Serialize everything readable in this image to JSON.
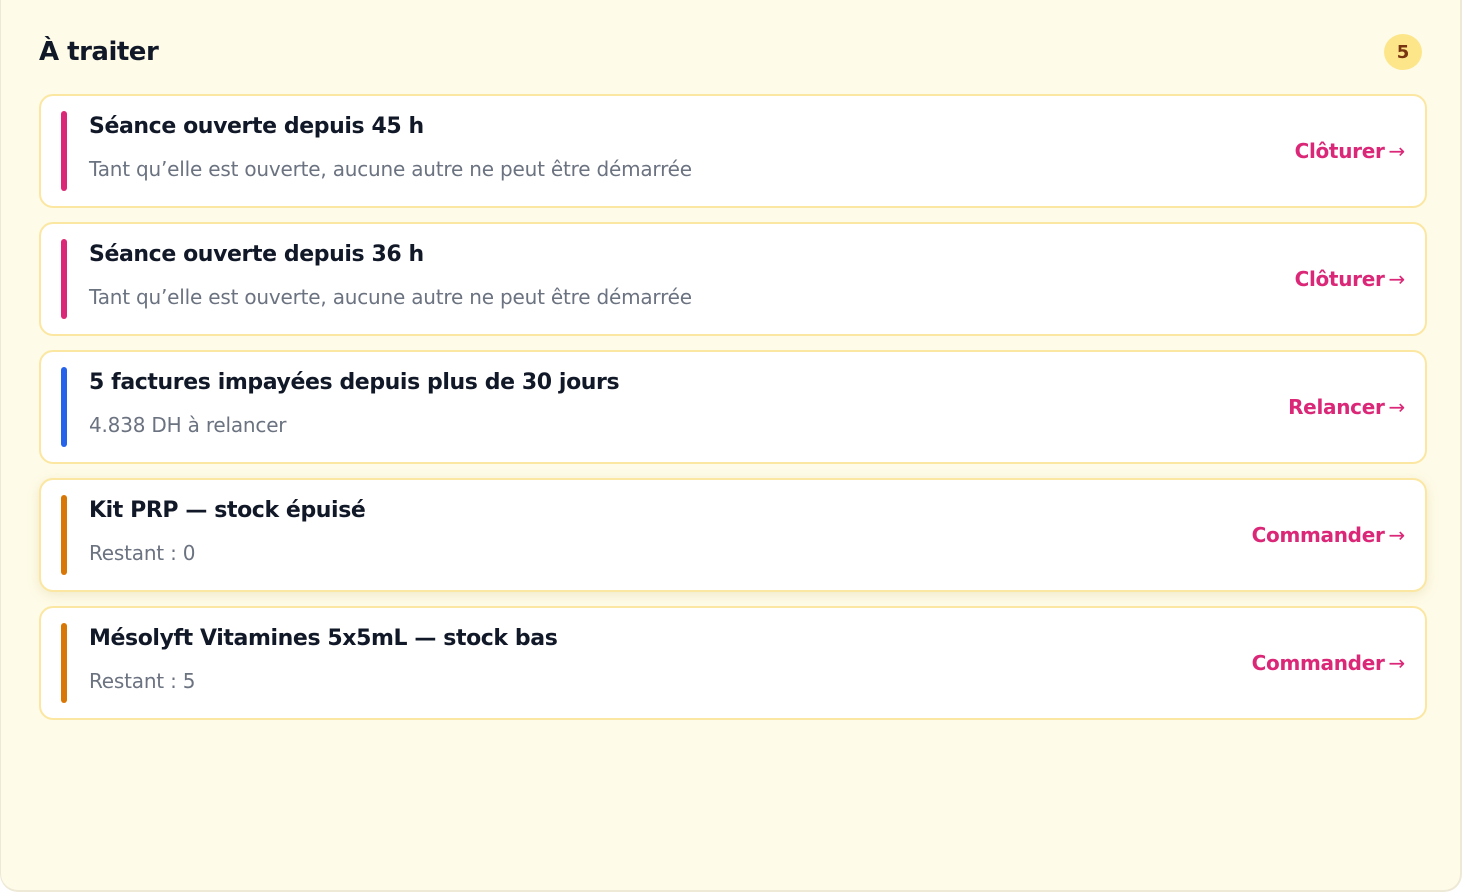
{
  "header": {
    "title": "À traiter",
    "count": "5"
  },
  "items": [
    {
      "title": "Séance ouverte depuis 45 h",
      "subtitle": "Tant qu’elle est ouverte, aucune autre ne peut être démarrée",
      "action": "Clôturer",
      "accent_color": "#db2777"
    },
    {
      "title": "Séance ouverte depuis 36 h",
      "subtitle": "Tant qu’elle est ouverte, aucune autre ne peut être démarrée",
      "action": "Clôturer",
      "accent_color": "#db2777"
    },
    {
      "title": "5 factures impayées depuis plus de 30 jours",
      "subtitle": "4.838 DH à relancer",
      "action": "Relancer",
      "accent_color": "#2563eb"
    },
    {
      "title": "Kit PRP — stock épuisé",
      "subtitle": "Restant : 0",
      "action": "Commander",
      "accent_color": "#d97706"
    },
    {
      "title": "Mésolyft Vitamines 5x5mL — stock bas",
      "subtitle": "Restant : 5",
      "action": "Commander",
      "accent_color": "#d97706"
    }
  ],
  "arrow_glyph": "→",
  "colors": {
    "action": "#db2777",
    "card_border": "#fbe7a1",
    "panel_background": "#fefbe8",
    "badge_background": "#fde68a"
  }
}
